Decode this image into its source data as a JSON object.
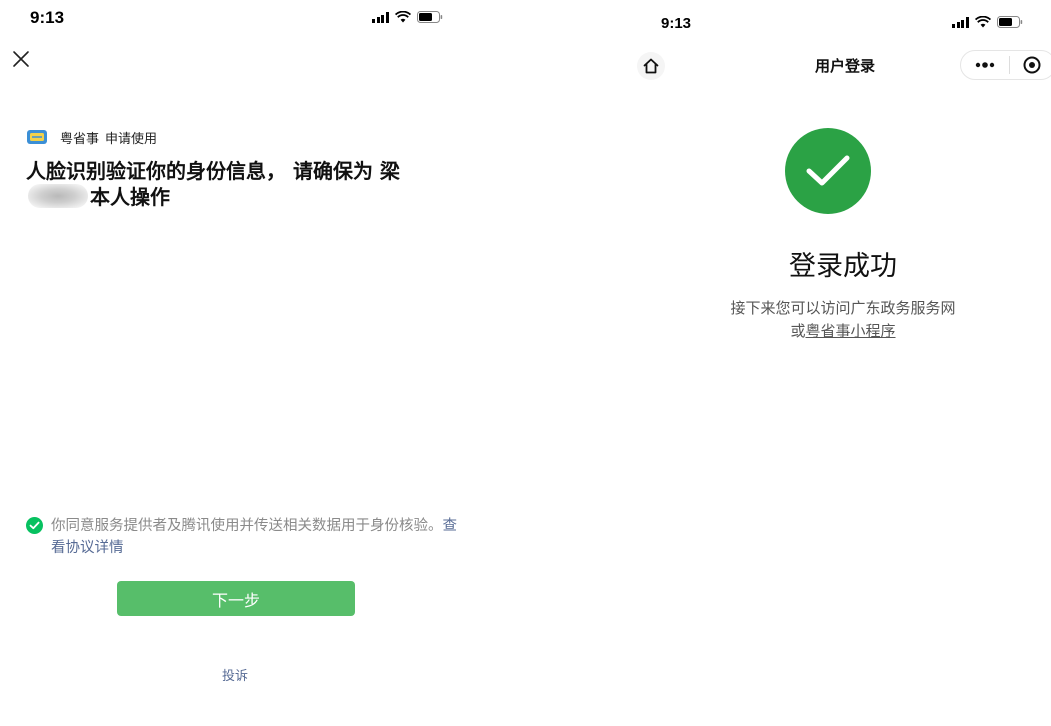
{
  "left": {
    "status": {
      "time": "9:13"
    },
    "app": {
      "name": "粤省事",
      "action": "申请使用"
    },
    "title": {
      "prefix": "人脸识别验证你的身份信息， 请确保为 梁",
      "suffix": "本人操作"
    },
    "consent": {
      "text": "你同意服务提供者及腾讯使用并传送相关数据用于身份核验。",
      "link": "查看协议详情"
    },
    "next_button": "下一步",
    "complaint": "投诉"
  },
  "right": {
    "status": {
      "time": "9:13"
    },
    "nav_title": "用户登录",
    "success_title": "登录成功",
    "desc_line1": "接下来您可以访问广东政务服务网",
    "desc_prefix": "或",
    "desc_link": "粤省事小程序"
  },
  "colors": {
    "accent_green": "#57be6a",
    "check_green": "#07c160",
    "success_green": "#2ba245",
    "link_blue": "#576b95"
  },
  "icons": [
    "close-icon",
    "app-logo-icon",
    "check-icon",
    "home-icon",
    "more-icon",
    "target-icon",
    "signal-icon",
    "wifi-icon",
    "battery-icon"
  ]
}
